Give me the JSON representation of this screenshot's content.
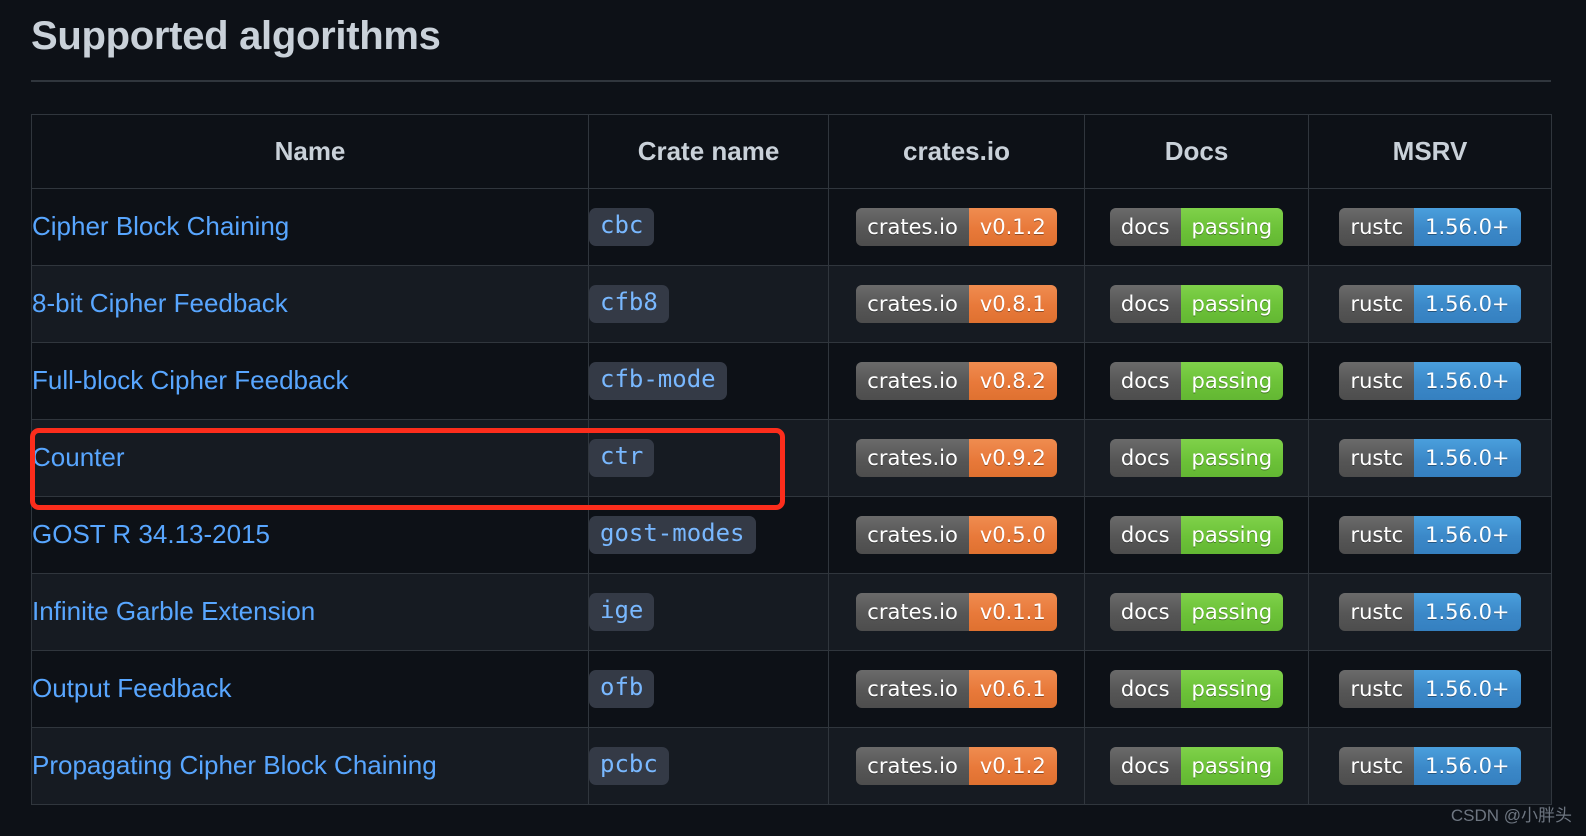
{
  "page": {
    "title": "Supported algorithms",
    "watermark": "CSDN @小胖头",
    "background_color": "#0d1117",
    "link_color": "#58a6ff",
    "annotation_color": "#fc2d1c"
  },
  "table": {
    "columns": [
      {
        "key": "name",
        "label": "Name"
      },
      {
        "key": "crate",
        "label": "Crate name"
      },
      {
        "key": "crates_io",
        "label": "crates.io"
      },
      {
        "key": "docs",
        "label": "Docs"
      },
      {
        "key": "msrv",
        "label": "MSRV"
      }
    ],
    "rows": [
      {
        "name": "Cipher Block Chaining",
        "crate": "cbc",
        "crates_io": {
          "label": "crates.io",
          "value": "v0.1.2"
        },
        "docs": {
          "label": "docs",
          "value": "passing"
        },
        "msrv": {
          "label": "rustc",
          "value": "1.56.0+"
        },
        "highlighted": false
      },
      {
        "name": "8-bit Cipher Feedback",
        "crate": "cfb8",
        "crates_io": {
          "label": "crates.io",
          "value": "v0.8.1"
        },
        "docs": {
          "label": "docs",
          "value": "passing"
        },
        "msrv": {
          "label": "rustc",
          "value": "1.56.0+"
        },
        "highlighted": false
      },
      {
        "name": "Full-block Cipher Feedback",
        "crate": "cfb-mode",
        "crates_io": {
          "label": "crates.io",
          "value": "v0.8.2"
        },
        "docs": {
          "label": "docs",
          "value": "passing"
        },
        "msrv": {
          "label": "rustc",
          "value": "1.56.0+"
        },
        "highlighted": false
      },
      {
        "name": "Counter",
        "crate": "ctr",
        "crates_io": {
          "label": "crates.io",
          "value": "v0.9.2"
        },
        "docs": {
          "label": "docs",
          "value": "passing"
        },
        "msrv": {
          "label": "rustc",
          "value": "1.56.0+"
        },
        "highlighted": true
      },
      {
        "name": "GOST R 34.13-2015",
        "crate": "gost-modes",
        "crates_io": {
          "label": "crates.io",
          "value": "v0.5.0"
        },
        "docs": {
          "label": "docs",
          "value": "passing"
        },
        "msrv": {
          "label": "rustc",
          "value": "1.56.0+"
        },
        "highlighted": false
      },
      {
        "name": "Infinite Garble Extension",
        "crate": "ige",
        "crates_io": {
          "label": "crates.io",
          "value": "v0.1.1"
        },
        "docs": {
          "label": "docs",
          "value": "passing"
        },
        "msrv": {
          "label": "rustc",
          "value": "1.56.0+"
        },
        "highlighted": false
      },
      {
        "name": "Output Feedback",
        "crate": "ofb",
        "crates_io": {
          "label": "crates.io",
          "value": "v0.6.1"
        },
        "docs": {
          "label": "docs",
          "value": "passing"
        },
        "msrv": {
          "label": "rustc",
          "value": "1.56.0+"
        },
        "highlighted": false
      },
      {
        "name": "Propagating Cipher Block Chaining",
        "crate": "pcbc",
        "crates_io": {
          "label": "crates.io",
          "value": "v0.1.2"
        },
        "docs": {
          "label": "docs",
          "value": "passing"
        },
        "msrv": {
          "label": "rustc",
          "value": "1.56.0+"
        },
        "highlighted": false
      }
    ]
  }
}
